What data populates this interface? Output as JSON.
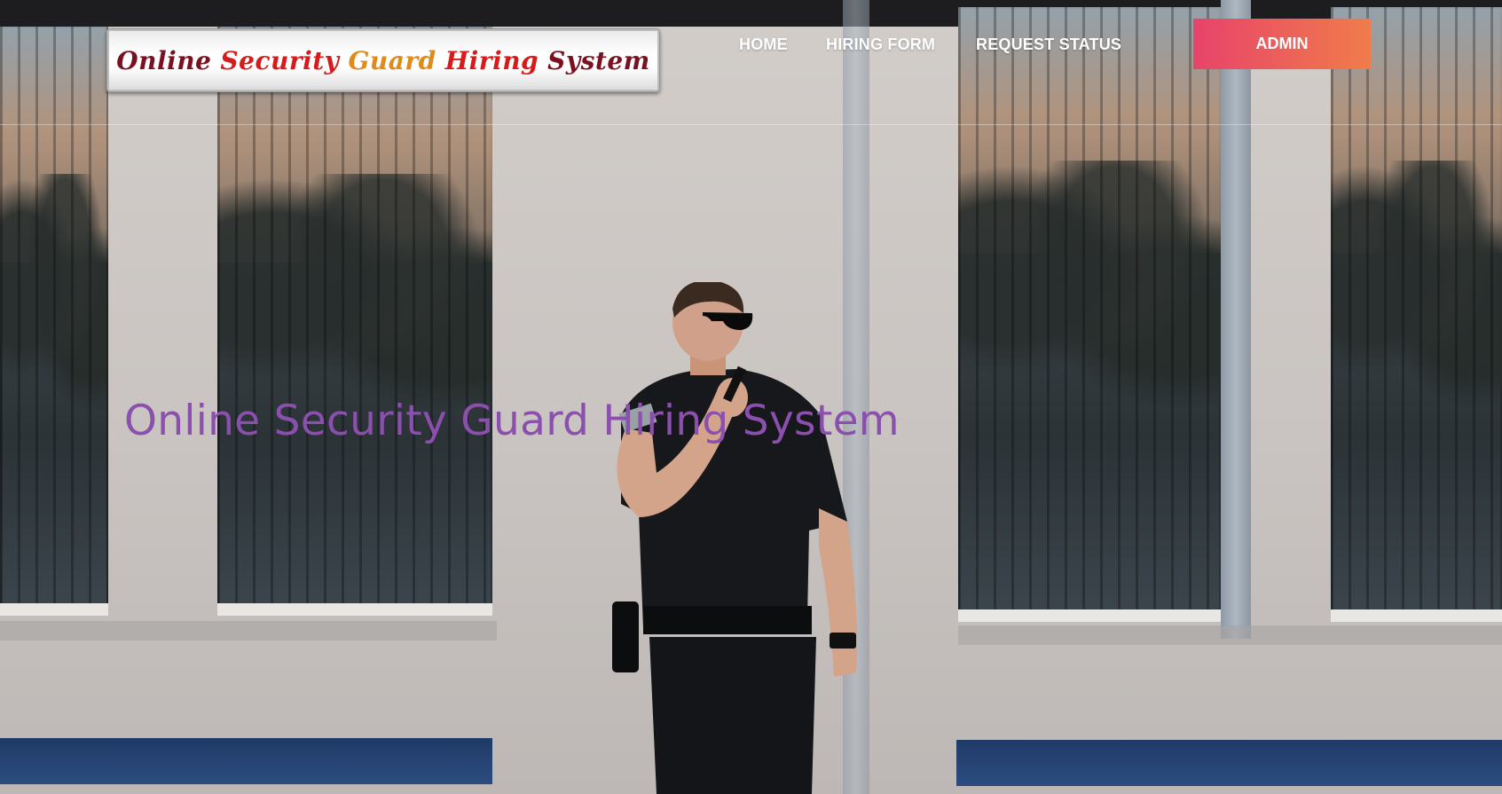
{
  "header": {
    "logo_words": [
      "Online",
      "Security",
      "Guard",
      "Hiring",
      "System"
    ],
    "logo_colors": [
      "#7a1020",
      "#d81a1a",
      "#e08a1a",
      "#d81a1a",
      "#7a1020"
    ],
    "nav": {
      "home": "HOME",
      "hiring_form": "HIRING FORM",
      "request_status": "REQUEST STATUS",
      "admin": "ADMIN"
    },
    "admin_border_gradient": [
      "#e8436a",
      "#f07c4a"
    ]
  },
  "hero": {
    "title": "Online Security Guard Hiring System",
    "title_color": "#8b4fae"
  },
  "background": {
    "description_icon": "security-guard-photo"
  }
}
